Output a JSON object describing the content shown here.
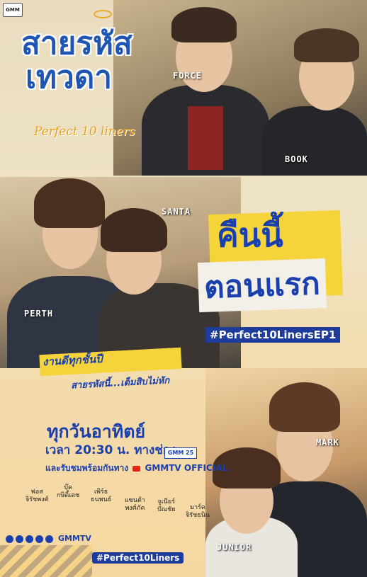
{
  "logo": {
    "brand": "GMM"
  },
  "title": {
    "thai_line1": "สายรหัส",
    "thai_line2": "เทวดา",
    "english": "Perfect 10 liners"
  },
  "cast_labels": {
    "force": "FORCE",
    "book": "BOOK",
    "santa": "SANTA",
    "perth": "PERTH",
    "mark": "MARK",
    "junior": "JUNIOR"
  },
  "headline": {
    "line1": "คืนนี้",
    "line2": "ตอนแรก",
    "hashtag": "#Perfect10LinersEP1"
  },
  "tagline": {
    "line1": "งานดีทุกชั้นปี",
    "line2": "สายรหัสนี้...เต็มสิบไม่หัก"
  },
  "schedule": {
    "day": "ทุกวันอาทิตย์",
    "time": "เวลา 20:30 น. ทางช่อง",
    "channel_badge": "GMM 25",
    "watch_prefix": "และรับชมพร้อมกันทาง",
    "watch_channel": "GMMTV OFFICIAL"
  },
  "credits": [
    {
      "name": "ฟอส",
      "sub": "จิรัชพงศ์"
    },
    {
      "name": "บุ๊ค",
      "sub": "กษิดิ์เดช"
    },
    {
      "name": "เพิร์ธ",
      "sub": "ธนพนธ์"
    },
    {
      "name": "แซนต้า",
      "sub": "พงศ์ภัค"
    },
    {
      "name": "จูเนียร์",
      "sub": "ปัณชัย"
    },
    {
      "name": "มาร์ค",
      "sub": "จิรัชธนิน"
    }
  ],
  "footer": {
    "social_handle": "GMMTV",
    "hashtag": "#Perfect10Liners"
  },
  "colors": {
    "brand_blue": "#1a3fae",
    "highlight_yellow": "#f5d33a",
    "title_orange": "#e8a21c"
  }
}
